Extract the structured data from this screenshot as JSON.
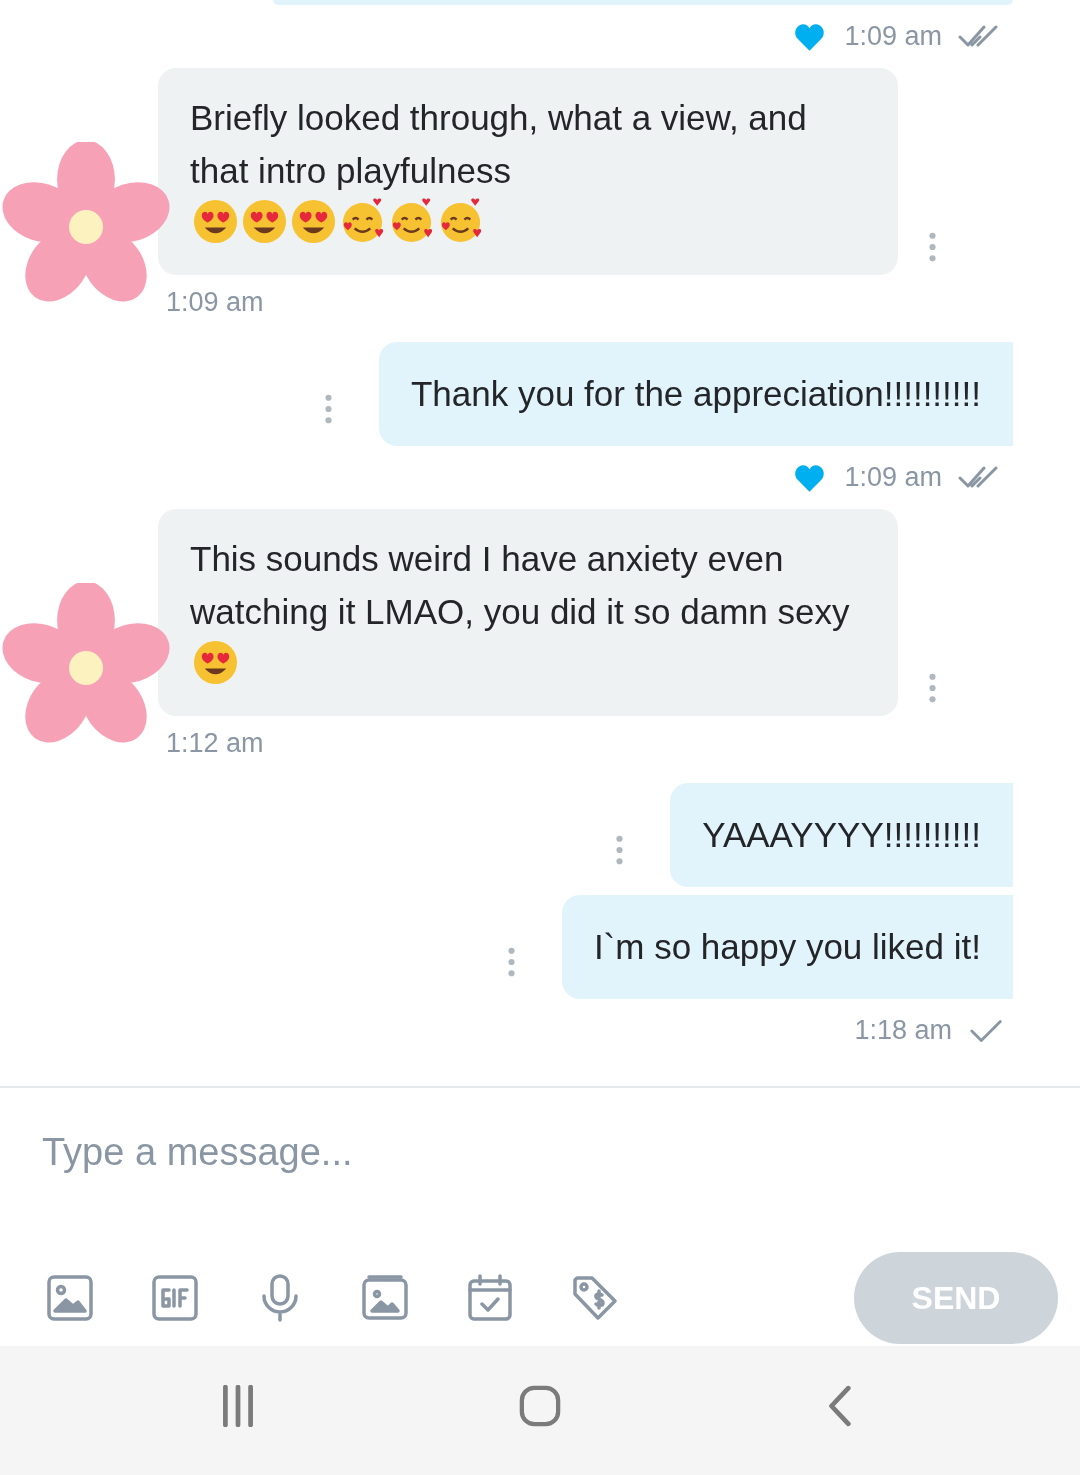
{
  "messages": [
    {
      "kind": "status",
      "liked": true,
      "time": "1:09 am",
      "read": true
    },
    {
      "kind": "incoming",
      "text": "Briefly looked through, what a view, and that intro playfulness",
      "emoji": [
        {
          "kind": "heart_eyes"
        },
        {
          "kind": "heart_eyes"
        },
        {
          "kind": "heart_eyes"
        },
        {
          "kind": "hearts"
        },
        {
          "kind": "hearts"
        },
        {
          "kind": "hearts"
        }
      ],
      "time": "1:09 am",
      "sticker": true
    },
    {
      "kind": "outgoing",
      "text": "Thank you for the appreciation!!!!!!!!!!"
    },
    {
      "kind": "status",
      "liked": true,
      "time": "1:09 am",
      "read": true
    },
    {
      "kind": "incoming",
      "text": "This sounds weird I have anxiety even watching it LMAO, you did it so damn sexy",
      "emoji": [
        {
          "kind": "heart_eyes"
        }
      ],
      "time": "1:12 am",
      "sticker": true
    },
    {
      "kind": "outgoing",
      "text": "YAAAYYYY!!!!!!!!!!"
    },
    {
      "kind": "outgoing",
      "text": "I`m so happy you liked it!"
    },
    {
      "kind": "status",
      "liked": false,
      "time": "1:18 am",
      "read": false
    }
  ],
  "composer": {
    "placeholder": "Type a message...",
    "send": "SEND",
    "send_disabled": true
  }
}
